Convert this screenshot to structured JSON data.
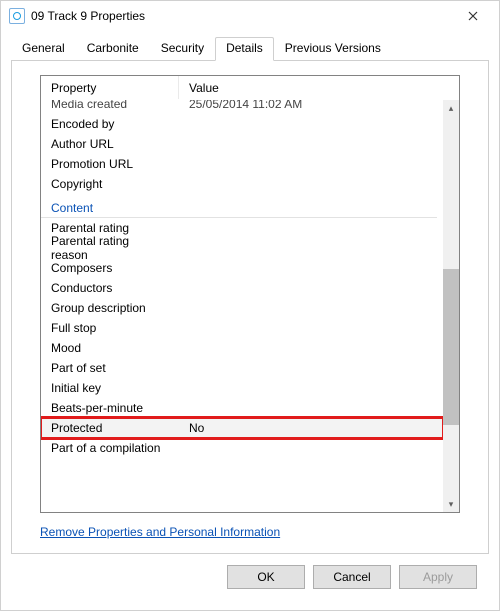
{
  "window": {
    "title": "09 Track 9 Properties"
  },
  "tabs": {
    "items": [
      {
        "label": "General"
      },
      {
        "label": "Carbonite"
      },
      {
        "label": "Security"
      },
      {
        "label": "Details"
      },
      {
        "label": "Previous Versions"
      }
    ],
    "active_index": 3
  },
  "details": {
    "columns": {
      "property": "Property",
      "value": "Value"
    },
    "cut_top": {
      "property": "Media created",
      "value": "25/05/2014 11:02 AM"
    },
    "rows": [
      {
        "property": "Encoded by",
        "value": ""
      },
      {
        "property": "Author URL",
        "value": ""
      },
      {
        "property": "Promotion URL",
        "value": ""
      },
      {
        "property": "Copyright",
        "value": ""
      }
    ],
    "group_content": {
      "label": "Content"
    },
    "rows2": [
      {
        "property": "Parental rating",
        "value": ""
      },
      {
        "property": "Parental rating reason",
        "value": ""
      },
      {
        "property": "Composers",
        "value": ""
      },
      {
        "property": "Conductors",
        "value": ""
      },
      {
        "property": "Group description",
        "value": ""
      },
      {
        "property": "Full stop",
        "value": ""
      },
      {
        "property": "Mood",
        "value": ""
      },
      {
        "property": "Part of set",
        "value": ""
      },
      {
        "property": "Initial key",
        "value": ""
      },
      {
        "property": "Beats-per-minute",
        "value": ""
      }
    ],
    "highlight": {
      "property": "Protected",
      "value": "No"
    },
    "rows3": [
      {
        "property": "Part of a compilation",
        "value": ""
      }
    ],
    "link": "Remove Properties and Personal Information"
  },
  "buttons": {
    "ok": "OK",
    "cancel": "Cancel",
    "apply": "Apply"
  },
  "scrollbar": {
    "thumb_top_pct": 41,
    "thumb_height_pct": 38
  }
}
